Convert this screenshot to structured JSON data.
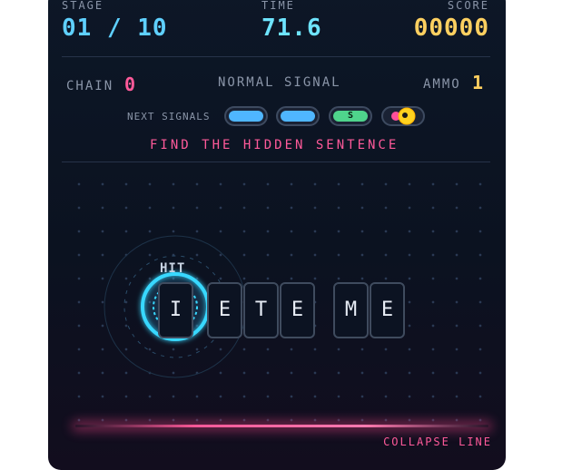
{
  "hud": {
    "stage_label": "STAGE",
    "stage_value": "01 / 10",
    "time_label": "TIME",
    "time_value": "71.6",
    "score_label": "SCORE",
    "score_value": "00000"
  },
  "status": {
    "chain_label": "CHAIN",
    "chain_value": "0",
    "signal_mode": "NORMAL SIGNAL",
    "ammo_label": "AMMO",
    "ammo_value": "1"
  },
  "next_signals": {
    "label": "NEXT SIGNALS",
    "items": [
      {
        "type": "blue",
        "text": ""
      },
      {
        "type": "blue",
        "text": ""
      },
      {
        "type": "green",
        "text": "S"
      },
      {
        "type": "bomb",
        "text": ""
      }
    ]
  },
  "instruction": "FIND THE HIDDEN SENTENCE",
  "board": {
    "hit_text": "HIT",
    "tiles": [
      "I",
      "E",
      "T",
      "E",
      "M",
      "E"
    ]
  },
  "collapse_label": "COLLAPSE LINE",
  "colors": {
    "stage": "#5fd0ff",
    "time": "#6ee4ff",
    "score": "#ffd060",
    "chain": "#ff5a9a",
    "ammo": "#ffd060",
    "accent_pink": "#ff5a9a",
    "signal_blue": "#4fb6ff",
    "signal_green": "#4fd48c",
    "bomb_yellow": "#ffd21f"
  }
}
